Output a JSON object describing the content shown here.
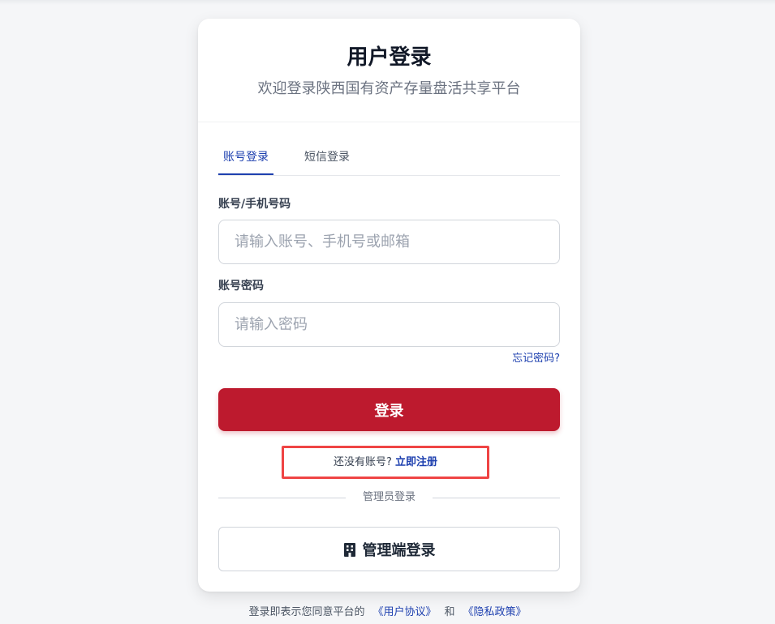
{
  "header": {
    "title": "用户登录",
    "subtitle": "欢迎登录陕西国有资产存量盘活共享平台"
  },
  "tabs": [
    {
      "label": "账号登录",
      "active": true
    },
    {
      "label": "短信登录",
      "active": false
    }
  ],
  "form": {
    "account_label": "账号/手机号码",
    "account_placeholder": "请输入账号、手机号或邮箱",
    "account_value": "",
    "password_label": "账号密码",
    "password_placeholder": "请输入密码",
    "password_value": "",
    "forgot_label": "忘记密码?",
    "login_label": "登录"
  },
  "register": {
    "prompt": "还没有账号?",
    "link_label": "立即注册"
  },
  "admin": {
    "divider_label": "管理员登录",
    "button_label": "管理端登录",
    "icon": "building-icon"
  },
  "footer": {
    "prefix": "登录即表示您同意平台的",
    "user_agreement": "《用户协议》",
    "conjunction": "和",
    "privacy_policy": "《隐私政策》"
  },
  "colors": {
    "primary_red": "#bd1a2e",
    "link_blue": "#1e40af",
    "highlight_border": "#ef4444"
  }
}
